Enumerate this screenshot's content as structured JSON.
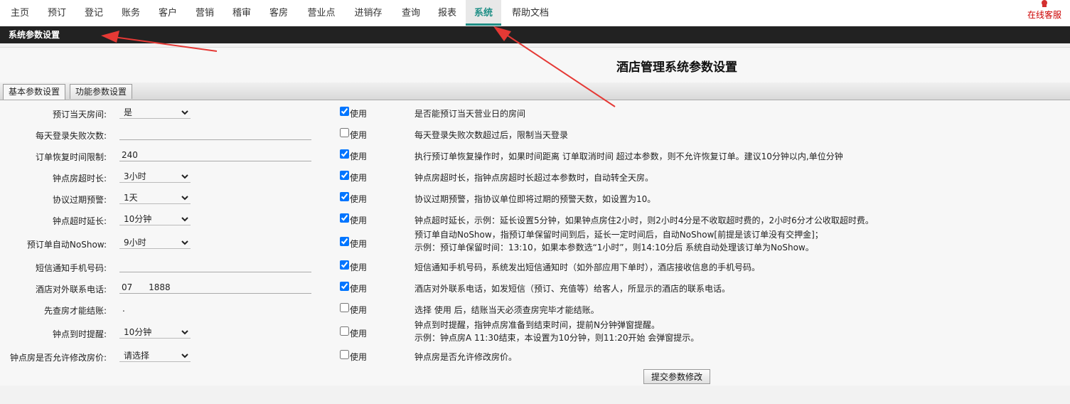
{
  "nav": {
    "items": [
      "主页",
      "预订",
      "登记",
      "账务",
      "客户",
      "营销",
      "稽审",
      "客房",
      "营业点",
      "进销存",
      "查询",
      "报表",
      "系统",
      "帮助文档"
    ],
    "active_index": 12,
    "service_label": "在线客服",
    "service_icon": "customer-service-icon",
    "active_color": "#1f8f86"
  },
  "section_title": "系统参数设置",
  "page_title": "酒店管理系统参数设置",
  "tabs": [
    "基本参数设置",
    "功能参数设置"
  ],
  "use_label": "使用",
  "rows": [
    {
      "label": "预订当天房间:",
      "type": "select",
      "value": "是",
      "checked": true,
      "desc": "是否能预订当天营业日的房间"
    },
    {
      "label": "每天登录失败次数:",
      "type": "text",
      "value": "",
      "checked": false,
      "desc": "每天登录失败次数超过后，限制当天登录"
    },
    {
      "label": "订单恢复时间限制:",
      "type": "text",
      "value": "240",
      "checked": true,
      "desc": "执行预订单恢复操作时，如果时间距离 订单取消时间 超过本参数，则不允许恢复订单。建议10分钟以内,单位分钟"
    },
    {
      "label": "钟点房超时长:",
      "type": "select",
      "value": "3小时",
      "checked": true,
      "desc": "钟点房超时长，指钟点房超时长超过本参数时，自动转全天房。"
    },
    {
      "label": "协议过期预警:",
      "type": "select",
      "value": "1天",
      "checked": true,
      "desc": "协议过期预警，指协议单位即将过期的预警天数，如设置为10。"
    },
    {
      "label": "钟点超时延长:",
      "type": "select",
      "value": "10分钟",
      "checked": true,
      "desc": "钟点超时延长，示例：延长设置5分钟，如果钟点房住2小时，则2小时4分是不收取超时费的，2小时6分才公收取超时费。"
    },
    {
      "label": "预订单自动NoShow:",
      "type": "select",
      "value": "9小时",
      "checked": true,
      "desc": "预订单自动NoShow，指预订单保留时间到后，延长一定时间后，自动NoShow[前提是该订单没有交押金]；",
      "desc2": "示例：预订单保留时间：13:10，如果本参数选“1小时”，则14:10分后 系统自动处理该订单为NoShow。"
    },
    {
      "label": "短信通知手机号码:",
      "type": "text",
      "value": "",
      "checked": true,
      "desc": "短信通知手机号码，系统发出短信通知时（如外部应用下单时），酒店接收信息的手机号码。"
    },
    {
      "label": "酒店对外联系电话:",
      "type": "text",
      "value": "07      1888",
      "checked": true,
      "desc": "酒店对外联系电话，如发短信（预订、充值等）给客人，所显示的酒店的联系电话。"
    },
    {
      "label": "先查房才能结账:",
      "type": "static",
      "value": ".",
      "checked": false,
      "desc": "选择 使用 后，结账当天必须查房完毕才能结账。"
    },
    {
      "label": "钟点到时提醒:",
      "type": "select",
      "value": "10分钟",
      "checked": false,
      "desc": "钟点到时提醒，指钟点房准备到结束时间，提前N分钟弹窗提醒。",
      "desc2": "示例：钟点房A 11:30结束，本设置为10分钟，则11:20开始 会弹窗提示。"
    },
    {
      "label": "钟点房是否允许修改房价:",
      "type": "select",
      "value": "请选择",
      "checked": false,
      "desc": "钟点房是否允许修改房价。"
    }
  ],
  "submit_label": "提交参数修改",
  "annotation_color": "#e53935"
}
